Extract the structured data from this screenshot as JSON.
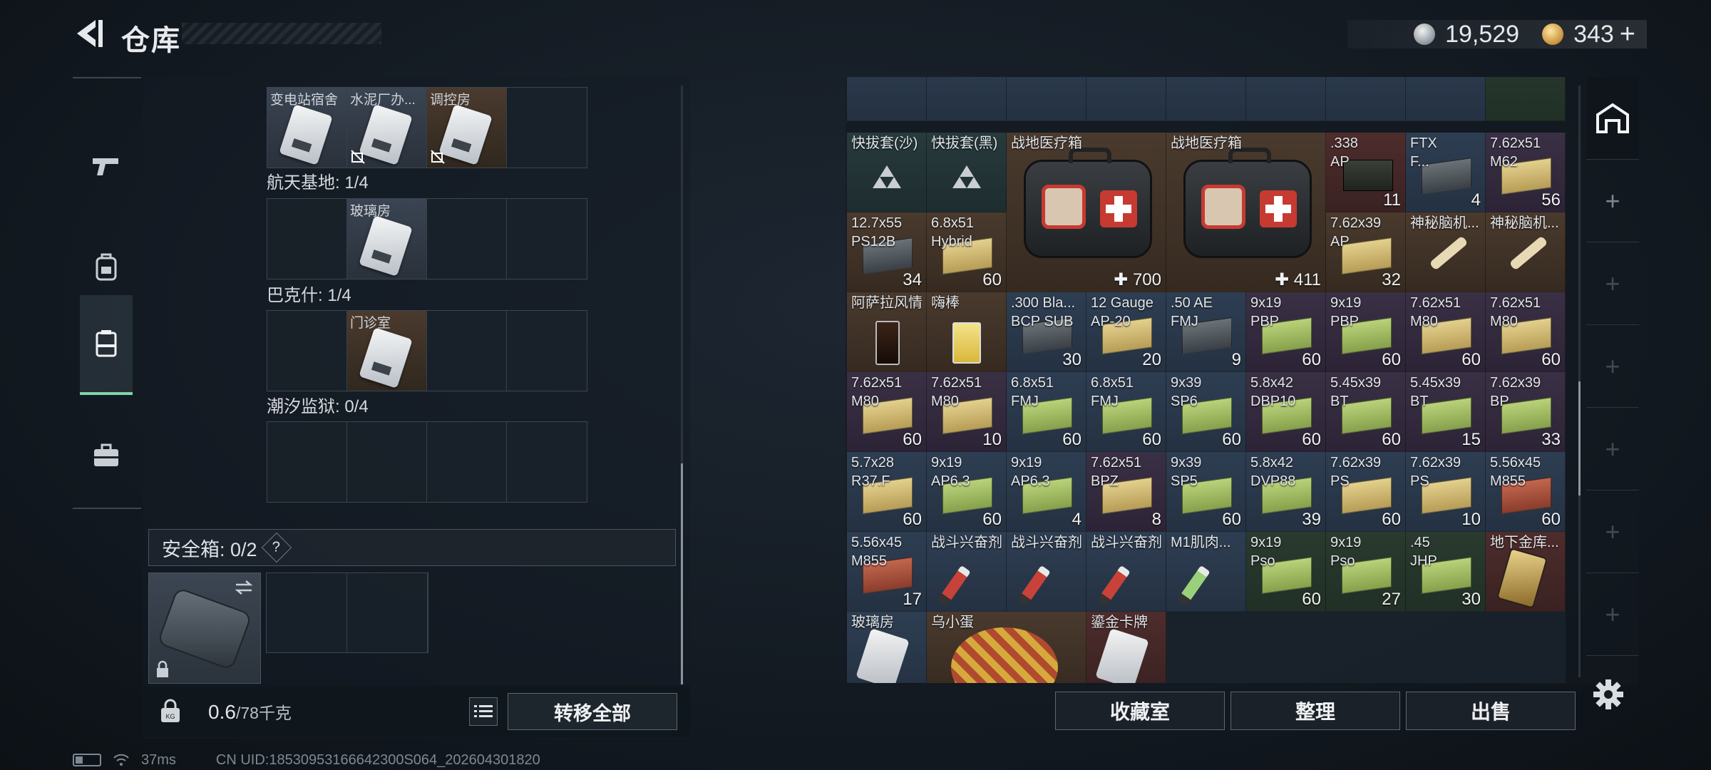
{
  "header": {
    "title": "仓库",
    "currency_silver": "19,529",
    "currency_gold": "343",
    "currency_gold_add": "+"
  },
  "left_tabs": [
    {
      "icon": "pistol-icon"
    },
    {
      "icon": "backpack-icon"
    },
    {
      "icon": "container-icon",
      "active": true
    },
    {
      "icon": "briefcase-icon"
    }
  ],
  "key_section": {
    "top_row_labels": [
      "变电站宿舍",
      "水泥厂办...",
      "调控房"
    ],
    "aerospace_label": "航天基地: 1/4",
    "aerospace_card": "玻璃房",
    "bakesh_label": "巴克什: 1/4",
    "bakesh_card": "门诊室",
    "prison_label": "潮汐监狱: 0/4"
  },
  "safebox": {
    "label": "安全箱: 0/2",
    "help": "?"
  },
  "footer_left": {
    "weight_current": "0.6",
    "weight_max": "/78千克",
    "transfer_all": "转移全部"
  },
  "inventory": {
    "rows": [
      {
        "row": 1,
        "items": [
          {
            "name": "快拔套(沙)"
          },
          {
            "name": "快拔套(黑)"
          },
          {
            "name": "战地医疗箱",
            "count": "✚ 700"
          },
          {
            "name": "战地医疗箱",
            "count": "✚ 411"
          },
          {
            "name": ".338\nAP",
            "count": "11"
          },
          {
            "name": "FTX\nF...",
            "count": "4"
          },
          {
            "name": "7.62x51\nM62",
            "count": "56"
          }
        ]
      },
      {
        "row": 2,
        "items": [
          {
            "name": "12.7x55\nPS12B",
            "count": "34"
          },
          {
            "name": "6.8x51\nHybrid",
            "count": "60"
          },
          {
            "name": "7.62x39\nAP",
            "count": "32"
          },
          {
            "name": "神秘脑机...",
            "count": ""
          },
          {
            "name": "神秘脑机...",
            "count": ""
          }
        ]
      },
      {
        "row": 3,
        "items": [
          {
            "name": "阿萨拉风情",
            "count": ""
          },
          {
            "name": "嗨棒",
            "count": ""
          },
          {
            "name": ".300 Bla...\nBCP SUB",
            "count": "30"
          },
          {
            "name": "12 Gauge\nAP-20",
            "count": "20"
          },
          {
            "name": ".50 AE\nFMJ",
            "count": "9"
          },
          {
            "name": "9x19\nPBP",
            "count": "60"
          },
          {
            "name": "9x19\nPBP",
            "count": "60"
          },
          {
            "name": "7.62x51\nM80",
            "count": "60"
          },
          {
            "name": "7.62x51\nM80",
            "count": "60"
          }
        ]
      },
      {
        "row": 4,
        "items": [
          {
            "name": "7.62x51\nM80",
            "count": "60"
          },
          {
            "name": "7.62x51\nM80",
            "count": "10"
          },
          {
            "name": "6.8x51\nFMJ",
            "count": "60"
          },
          {
            "name": "6.8x51\nFMJ",
            "count": "60"
          },
          {
            "name": "9x39\nSP6",
            "count": "60"
          },
          {
            "name": "5.8x42\nDBP10",
            "count": "60"
          },
          {
            "name": "5.45x39\nBT",
            "count": "60"
          },
          {
            "name": "5.45x39\nBT",
            "count": "15"
          },
          {
            "name": "7.62x39\nBP",
            "count": "33"
          }
        ]
      },
      {
        "row": 5,
        "items": [
          {
            "name": "5.7x28\nR37.F",
            "count": "60"
          },
          {
            "name": "9x19\nAP6.3",
            "count": "60"
          },
          {
            "name": "9x19\nAP6.3",
            "count": "4"
          },
          {
            "name": "7.62x51\nBPZ",
            "count": "8"
          },
          {
            "name": "9x39\nSP5",
            "count": "60"
          },
          {
            "name": "5.8x42\nDVP88",
            "count": "39"
          },
          {
            "name": "7.62x39\nPS",
            "count": "60"
          },
          {
            "name": "7.62x39\nPS",
            "count": "10"
          },
          {
            "name": "5.56x45\nM855",
            "count": "60"
          }
        ]
      },
      {
        "row": 6,
        "items": [
          {
            "name": "5.56x45\nM855",
            "count": "17"
          },
          {
            "name": "战斗兴奋剂",
            "count": ""
          },
          {
            "name": "战斗兴奋剂",
            "count": ""
          },
          {
            "name": "战斗兴奋剂",
            "count": ""
          },
          {
            "name": "M1肌肉...",
            "count": ""
          },
          {
            "name": "9x19\nPso",
            "count": "60"
          },
          {
            "name": "9x19\nPso",
            "count": "27"
          },
          {
            "name": ".45\nJHP",
            "count": "30"
          },
          {
            "name": "地下金库...",
            "count": ""
          }
        ]
      },
      {
        "row": 7,
        "items": [
          {
            "name": "玻璃房",
            "count": ""
          },
          {
            "name": "乌小蛋",
            "count": ""
          },
          {
            "name": "鎏金卡牌",
            "count": ""
          }
        ]
      }
    ]
  },
  "footer_right": {
    "collection": "收藏室",
    "organize": "整理",
    "sell": "出售"
  },
  "right_tabs": [
    "warehouse-icon",
    "+",
    "+",
    "+",
    "+",
    "+",
    "+"
  ],
  "status": {
    "ping": "37ms",
    "uid": "CN UID:18530953166642300S064_202604301820"
  }
}
